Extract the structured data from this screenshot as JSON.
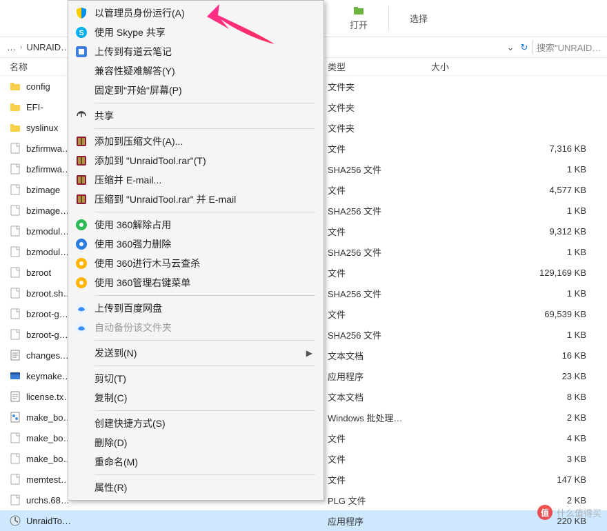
{
  "toolbar": {
    "open": "打开",
    "select": "选择"
  },
  "addressbar": {
    "crumb1": "…",
    "crumb2": "UNRAID…",
    "search_placeholder": "搜索\"UNRAID…"
  },
  "columns": {
    "name": "名称",
    "type": "类型",
    "size": "大小"
  },
  "files": [
    {
      "icon": "folder",
      "name": "config",
      "type": "文件夹",
      "size": ""
    },
    {
      "icon": "folder",
      "name": "EFI-",
      "type": "文件夹",
      "size": ""
    },
    {
      "icon": "folder",
      "name": "syslinux",
      "type": "文件夹",
      "size": ""
    },
    {
      "icon": "file",
      "name": "bzfirmwa…",
      "type": "文件",
      "size": "7,316 KB"
    },
    {
      "icon": "file",
      "name": "bzfirmwa…",
      "type": "SHA256 文件",
      "size": "1 KB"
    },
    {
      "icon": "file",
      "name": "bzimage",
      "type": "文件",
      "size": "4,577 KB"
    },
    {
      "icon": "file",
      "name": "bzimage…",
      "type": "SHA256 文件",
      "size": "1 KB"
    },
    {
      "icon": "file",
      "name": "bzmodul…",
      "type": "文件",
      "size": "9,312 KB"
    },
    {
      "icon": "file",
      "name": "bzmodul…",
      "type": "SHA256 文件",
      "size": "1 KB"
    },
    {
      "icon": "file",
      "name": "bzroot",
      "type": "文件",
      "size": "129,169 KB"
    },
    {
      "icon": "file",
      "name": "bzroot.sh…",
      "type": "SHA256 文件",
      "size": "1 KB"
    },
    {
      "icon": "file",
      "name": "bzroot-g…",
      "type": "文件",
      "size": "69,539 KB"
    },
    {
      "icon": "file",
      "name": "bzroot-g…",
      "type": "SHA256 文件",
      "size": "1 KB"
    },
    {
      "icon": "txt",
      "name": "changes.…",
      "type": "文本文档",
      "size": "16 KB"
    },
    {
      "icon": "exe",
      "name": "keymake…",
      "type": "应用程序",
      "size": "23 KB"
    },
    {
      "icon": "txt",
      "name": "license.tx…",
      "type": "文本文档",
      "size": "8 KB"
    },
    {
      "icon": "bat",
      "name": "make_bo…",
      "type": "Windows 批处理…",
      "size": "2 KB"
    },
    {
      "icon": "file",
      "name": "make_bo…",
      "type": "文件",
      "size": "4 KB"
    },
    {
      "icon": "file",
      "name": "make_bo…",
      "type": "文件",
      "size": "3 KB"
    },
    {
      "icon": "file",
      "name": "memtest…",
      "type": "文件",
      "size": "147 KB"
    },
    {
      "icon": "file",
      "name": "urchs.68…",
      "type": "PLG 文件",
      "size": "2 KB"
    },
    {
      "icon": "app",
      "name": "UnraidTo…",
      "type": "应用程序",
      "size": "220 KB",
      "selected": true
    }
  ],
  "context_menu": [
    {
      "icon": "shield",
      "label": "以管理员身份运行(A)"
    },
    {
      "icon": "skype",
      "label": "使用 Skype 共享"
    },
    {
      "icon": "youdao",
      "label": "上传到有道云笔记"
    },
    {
      "icon": "",
      "label": "兼容性疑难解答(Y)"
    },
    {
      "icon": "",
      "label": "固定到\"开始\"屏幕(P)"
    },
    {
      "sep": true
    },
    {
      "icon": "share",
      "label": "共享"
    },
    {
      "sep": true
    },
    {
      "icon": "rar",
      "label": "添加到压缩文件(A)..."
    },
    {
      "icon": "rar",
      "label": "添加到 \"UnraidTool.rar\"(T)"
    },
    {
      "icon": "rar",
      "label": "压缩并 E-mail..."
    },
    {
      "icon": "rar",
      "label": "压缩到 \"UnraidTool.rar\" 并 E-mail"
    },
    {
      "sep": true
    },
    {
      "icon": "360g",
      "label": "使用 360解除占用"
    },
    {
      "icon": "360b",
      "label": "使用 360强力删除"
    },
    {
      "icon": "360y",
      "label": "使用 360进行木马云查杀"
    },
    {
      "icon": "360y",
      "label": "使用 360管理右键菜单"
    },
    {
      "sep": true
    },
    {
      "icon": "baidu",
      "label": "上传到百度网盘"
    },
    {
      "icon": "baidu",
      "label": "自动备份该文件夹",
      "disabled": true
    },
    {
      "sep": true
    },
    {
      "icon": "",
      "label": "发送到(N)",
      "arrow": true
    },
    {
      "sep": true
    },
    {
      "icon": "",
      "label": "剪切(T)"
    },
    {
      "icon": "",
      "label": "复制(C)"
    },
    {
      "sep": true
    },
    {
      "icon": "",
      "label": "创建快捷方式(S)"
    },
    {
      "icon": "",
      "label": "删除(D)"
    },
    {
      "icon": "",
      "label": "重命名(M)"
    },
    {
      "sep": true
    },
    {
      "icon": "",
      "label": "属性(R)"
    }
  ],
  "watermark": "什么值得买"
}
